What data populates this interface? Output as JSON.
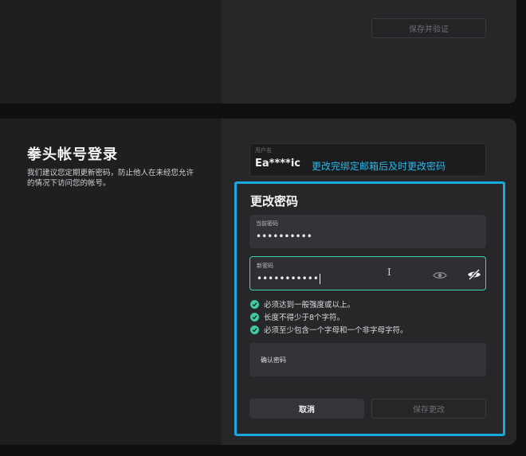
{
  "top_section": {
    "save_verify_label": "保存并验证"
  },
  "account": {
    "title": "拳头帐号登录",
    "description": "我们建议您定期更新密码，防止他人在未经您允许的情况下访问您的帐号。",
    "username_label": "用户名",
    "username_value": "Ea****ic"
  },
  "annotation": "更改完绑定邮箱后及时更改密码",
  "change_password": {
    "title": "更改密码",
    "current_label": "当前密码",
    "current_value": "••••••••••",
    "new_label": "新密码",
    "new_value": "•••••••••••",
    "rules": [
      "必须达到一般强度或以上。",
      "长度不得少于8个字符。",
      "必须至少包含一个字母和一个非字母字符。"
    ],
    "confirm_label": "确认密码",
    "cancel_label": "取消",
    "save_label": "保存更改"
  },
  "colors": {
    "accent_teal": "#3fd4b4",
    "highlight_blue": "#1aa8e0"
  }
}
